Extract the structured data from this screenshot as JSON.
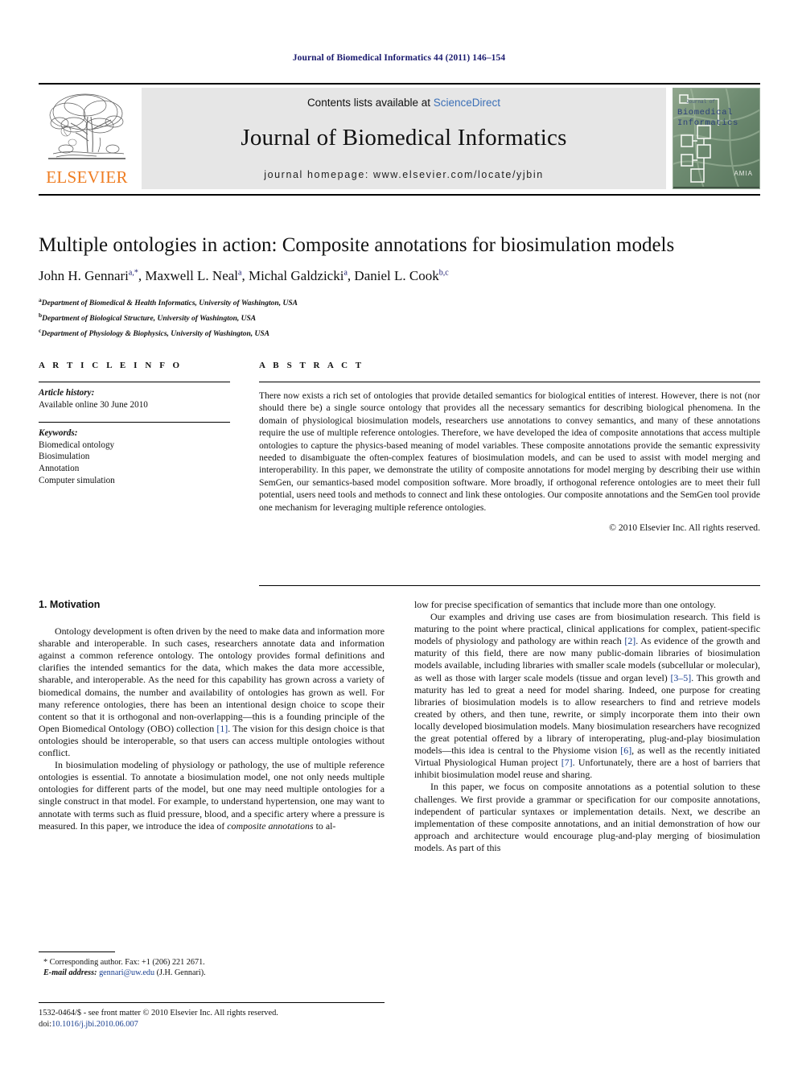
{
  "running_head": "Journal of Biomedical Informatics 44 (2011) 146–154",
  "masthead": {
    "publisher_word": "ELSEVIER",
    "contents_prefix": "Contents lists available at ",
    "contents_link": "ScienceDirect",
    "journal_name": "Journal of Biomedical Informatics",
    "homepage": "journal homepage: www.elsevier.com/locate/yjbin",
    "cover": {
      "small_line": "Journal of",
      "title_line1": "Biomedical",
      "title_line2": "Informatics",
      "mark": "AMIA"
    }
  },
  "article": {
    "title": "Multiple ontologies in action: Composite annotations for biosimulation models",
    "authors": [
      {
        "name": "John H. Gennari",
        "marks": "a,*"
      },
      {
        "name": "Maxwell L. Neal",
        "marks": "a"
      },
      {
        "name": "Michal Galdzicki",
        "marks": "a"
      },
      {
        "name": "Daniel L. Cook",
        "marks": "b,c"
      }
    ],
    "affiliations": [
      {
        "mark": "a",
        "text": "Department of Biomedical & Health Informatics, University of Washington, USA"
      },
      {
        "mark": "b",
        "text": "Department of Biological Structure, University of Washington, USA"
      },
      {
        "mark": "c",
        "text": "Department of Physiology & Biophysics, University of Washington, USA"
      }
    ]
  },
  "info": {
    "heading": "A R T I C L E    I N F O",
    "history_label": "Article history:",
    "history_value": "Available online 30 June 2010",
    "keywords_label": "Keywords:",
    "keywords": [
      "Biomedical ontology",
      "Biosimulation",
      "Annotation",
      "Computer simulation"
    ]
  },
  "abstract": {
    "heading": "A B S T R A C T",
    "text": "There now exists a rich set of ontologies that provide detailed semantics for biological entities of interest. However, there is not (nor should there be) a single source ontology that provides all the necessary semantics for describing biological phenomena. In the domain of physiological biosimulation models, researchers use annotations to convey semantics, and many of these annotations require the use of multiple reference ontologies. Therefore, we have developed the idea of composite annotations that access multiple ontologies to capture the physics-based meaning of model variables. These composite annotations provide the semantic expressivity needed to disambiguate the often-complex features of biosimulation models, and can be used to assist with model merging and interoperability. In this paper, we demonstrate the utility of composite annotations for model merging by describing their use within SemGen, our semantics-based model composition software. More broadly, if orthogonal reference ontologies are to meet their full potential, users need tools and methods to connect and link these ontologies. Our composite annotations and the SemGen tool provide one mechanism for leveraging multiple reference ontologies.",
    "copyright": "© 2010 Elsevier Inc. All rights reserved."
  },
  "body": {
    "section_heading": "1. Motivation",
    "left": {
      "p1": "Ontology development is often driven by the need to make data and information more sharable and interoperable. In such cases, researchers annotate data and information against a common reference ontology. The ontology provides formal definitions and clarifies the intended semantics for the data, which makes the data more accessible, sharable, and interoperable. As the need for this capability has grown across a variety of biomedical domains, the number and availability of ontologies has grown as well. For many reference ontologies, there has been an intentional design choice to scope their content so that it is orthogonal and non-overlapping—this is a founding principle of the Open Biomedical Ontology (OBO) collection ",
      "p1_ref": "[1]",
      "p1_after": ". The vision for this design choice is that ontologies should be interoperable, so that users can access multiple ontologies without conflict.",
      "p2_a": "In biosimulation modeling of physiology or pathology, the use of multiple reference ontologies is essential. To annotate a biosimulation model, one not only needs multiple ontologies for different parts of the model, but one may need multiple ontologies for a single construct in that model. For example, to understand hypertension, one may want to annotate with terms such as fluid pressure, blood, and a specific artery where a pressure is measured. In this paper, we introduce the idea of ",
      "p2_italic": "composite annotations",
      "p2_b": " to al-"
    },
    "right": {
      "p1_cont": "low for precise specification of semantics that include more than one ontology.",
      "p2_a": "Our examples and driving use cases are from biosimulation research. This field is maturing to the point where practical, clinical applications for complex, patient-specific models of physiology and pathology are within reach ",
      "p2_ref1": "[2]",
      "p2_b": ". As evidence of the growth and maturity of this field, there are now many public-domain libraries of biosimulation models available, including libraries with smaller scale models (subcellular or molecular), as well as those with larger scale models (tissue and organ level) ",
      "p2_ref2": "[3–5]",
      "p2_c": ". This growth and maturity has led to great a need for model sharing. Indeed, one purpose for creating libraries of biosimulation models is to allow researchers to find and retrieve models created by others, and then tune, rewrite, or simply incorporate them into their own locally developed biosimulation models. Many biosimulation researchers have recognized the great potential offered by a library of interoperating, plug-and-play biosimulation models—this idea is central to the Physiome vision ",
      "p2_ref3": "[6]",
      "p2_d": ", as well as the recently initiated Virtual Physiological Human project ",
      "p2_ref4": "[7]",
      "p2_e": ". Unfortunately, there are a host of barriers that inhibit biosimulation model reuse and sharing.",
      "p3": "In this paper, we focus on composite annotations as a potential solution to these challenges. We first provide a grammar or specification for our composite annotations, independent of particular syntaxes or implementation details. Next, we describe an implementation of these composite annotations, and an initial demonstration of how our approach and architecture would encourage plug-and-play merging of biosimulation models. As part of this"
    }
  },
  "footnote": {
    "corresponding": "* Corresponding author. Fax: +1 (206) 221 2671.",
    "email_label": "E-mail address:",
    "email": "gennari@uw.edu",
    "email_suffix": " (J.H. Gennari)."
  },
  "issn": {
    "line1": "1532-0464/$ - see front matter © 2010 Elsevier Inc. All rights reserved.",
    "doi_label": "doi:",
    "doi_value": "10.1016/j.jbi.2010.06.007"
  },
  "colors": {
    "link_blue": "#3b6fb6",
    "ref_blue": "#1a3f8f",
    "elsevier_orange": "#ef7d22",
    "masthead_grey": "#e6e6e6"
  }
}
